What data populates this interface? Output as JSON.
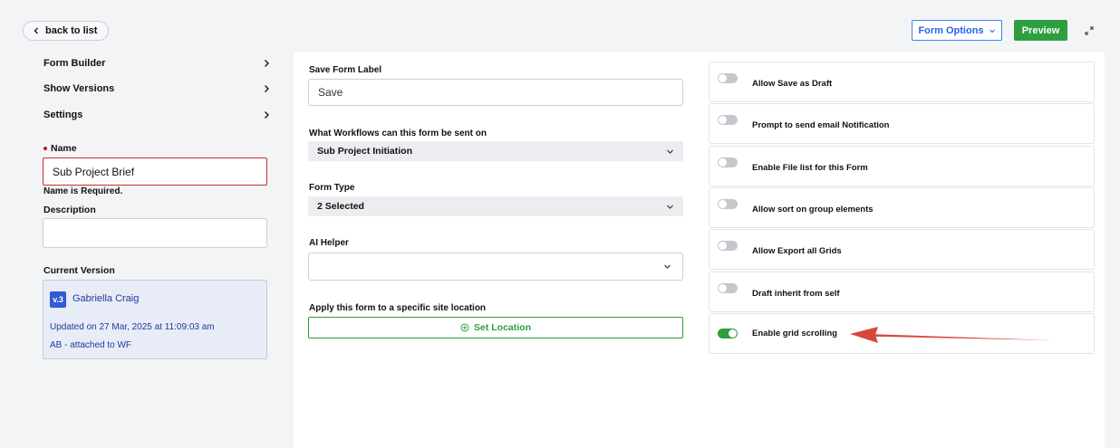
{
  "header": {
    "back_label": "back to list",
    "form_options_label": "Form Options",
    "preview_label": "Preview"
  },
  "sidebar": {
    "nav": [
      {
        "label": "Form Builder"
      },
      {
        "label": "Show Versions"
      },
      {
        "label": "Settings"
      }
    ],
    "name_label": "Name",
    "name_value": "Sub Project Brief",
    "name_error": "Name is Required.",
    "description_label": "Description",
    "description_value": "",
    "current_version_label": "Current Version",
    "version": {
      "badge": "v.3",
      "author": "Gabriella Craig",
      "updated": "Updated on 27 Mar, 2025 at 11:09:03 am",
      "note": "AB - attached to WF"
    }
  },
  "main": {
    "save_label_title": "Save Form Label",
    "save_label_value": "Save",
    "workflows_title": "What Workflows can this form be sent on",
    "workflows_value": "Sub Project Initiation",
    "form_type_title": "Form Type",
    "form_type_value": "2 Selected",
    "ai_helper_title": "AI Helper",
    "ai_helper_value": "",
    "location_title": "Apply this form to a specific site location",
    "location_button": "Set Location"
  },
  "options": [
    {
      "label": "Allow Save as Draft",
      "enabled": false
    },
    {
      "label": "Prompt to send email Notification",
      "enabled": false
    },
    {
      "label": "Enable File list for this Form",
      "enabled": false
    },
    {
      "label": "Allow sort on group elements",
      "enabled": false
    },
    {
      "label": "Allow Export all Grids",
      "enabled": false
    },
    {
      "label": "Draft inherit from self",
      "enabled": false
    },
    {
      "label": "Enable grid scrolling",
      "enabled": true
    }
  ],
  "colors": {
    "accent_green": "#2e9e3e",
    "accent_blue": "#2563eb",
    "error_red": "#c53030",
    "annotation_red": "#d9473a"
  }
}
